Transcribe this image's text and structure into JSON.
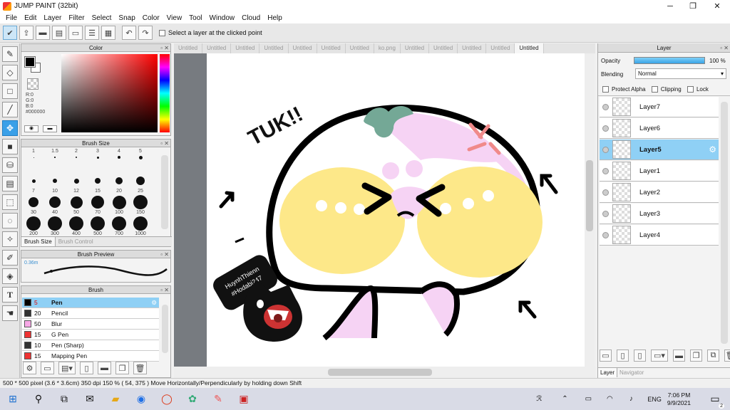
{
  "window": {
    "title": "JUMP PAINT (32bit)",
    "minimize": "─",
    "maximize": "❐",
    "close": "✕"
  },
  "menu": [
    "File",
    "Edit",
    "Layer",
    "Filter",
    "Select",
    "Snap",
    "Color",
    "View",
    "Tool",
    "Window",
    "Cloud",
    "Help"
  ],
  "toolbar": {
    "select_layer_label": "Select a layer at the clicked point"
  },
  "tools": [
    "brush-tool-icon",
    "eraser-tool-icon",
    "select-rect-tool-icon",
    "line-tool-icon",
    "move-tool-icon",
    "fill-rect-tool-icon",
    "bucket-tool-icon",
    "gradient-tool-icon",
    "select-tool-icon",
    "lasso-tool-icon",
    "magic-wand-tool-icon",
    "select-pen-tool-icon",
    "select-eraser-tool-icon",
    "text-tool-icon",
    "hand-tool-icon"
  ],
  "color_panel": {
    "title": "Color",
    "r": "R:0",
    "g": "G:0",
    "b": "B:0",
    "hex": "#000000"
  },
  "brush_size": {
    "title": "Brush Size",
    "sizes": [
      "1",
      "1.5",
      "2",
      "3",
      "4",
      "5",
      "7",
      "10",
      "12",
      "15",
      "20",
      "25",
      "30",
      "40",
      "50",
      "70",
      "100",
      "150",
      "200",
      "300",
      "400",
      "500",
      "700",
      "1000"
    ],
    "tab_active": "Brush Size",
    "tab_other": "Brush Control"
  },
  "brush_preview": {
    "title": "Brush Preview",
    "size_label": "0.36m"
  },
  "brush_panel": {
    "title": "Brush",
    "items": [
      {
        "size": "5",
        "name": "Pen",
        "color": "#000000",
        "selected": true
      },
      {
        "size": "20",
        "name": "Pencil",
        "color": "#333333",
        "selected": false
      },
      {
        "size": "50",
        "name": "Blur",
        "color": "#f7a8e6",
        "selected": false
      },
      {
        "size": "15",
        "name": "G Pen",
        "color": "#e33",
        "selected": false
      },
      {
        "size": "10",
        "name": "Pen (Sharp)",
        "color": "#333333",
        "selected": false
      },
      {
        "size": "15",
        "name": "Mapping Pen",
        "color": "#e33",
        "selected": false
      }
    ]
  },
  "tabs": [
    "Untitled",
    "Untitled",
    "Untitled",
    "Untitled",
    "Untitled",
    "Untitled",
    "Untitled",
    "ko.png",
    "Untitled",
    "Untitled",
    "Untitled",
    "Untitled",
    "Untitled"
  ],
  "active_tab_index": 12,
  "canvas_text": {
    "tuk": "TUK!!",
    "sticker_line1": "HuynhThienn",
    "sticker_line2": "#Hodabi247"
  },
  "layer_panel": {
    "title": "Layer",
    "opacity_label": "Opacity",
    "opacity_value": "100 %",
    "opacity_fraction": 1.0,
    "blending_label": "Blending",
    "blending_value": "Normal",
    "protect_alpha": "Protect Alpha",
    "clipping": "Clipping",
    "lock": "Lock",
    "layers": [
      {
        "name": "Layer7",
        "selected": false
      },
      {
        "name": "Layer6",
        "selected": false
      },
      {
        "name": "Layer5",
        "selected": true
      },
      {
        "name": "Layer1",
        "selected": false
      },
      {
        "name": "Layer2",
        "selected": false
      },
      {
        "name": "Layer3",
        "selected": false
      },
      {
        "name": "Layer4",
        "selected": false
      }
    ],
    "tab_layer": "Layer",
    "tab_navigator": "Navigator"
  },
  "status": {
    "text": "500 * 500 pixel   (3.6 * 3.6cm)   350 dpi   150 %   ( 54, 375 )   Move Horizontally/Perpendicularly by holding down Shift"
  },
  "taskbar": {
    "time": "7:06 PM",
    "date": "9/9/2021",
    "lang": "ENG",
    "notifications": "2"
  }
}
